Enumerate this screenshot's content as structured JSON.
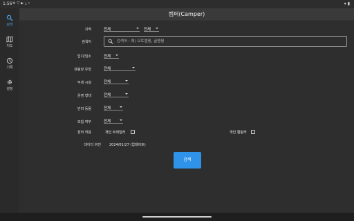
{
  "status_bar": {
    "time": "1:56",
    "icons": [
      "gear-icon",
      "shield-icon",
      "play-icon",
      "download-icon",
      "dot-icon"
    ],
    "right_icons": [
      "wifi-icon",
      "battery-icon"
    ]
  },
  "nav_rail": {
    "items": [
      {
        "label": "검색",
        "icon": "search-icon",
        "active": true
      },
      {
        "label": "지도",
        "icon": "map-icon",
        "active": false
      },
      {
        "label": "기록",
        "icon": "history-icon",
        "active": false
      },
      {
        "label": "설정",
        "icon": "settings-icon",
        "active": false
      }
    ]
  },
  "app_bar": {
    "title": "캠퍼(Camper)"
  },
  "form": {
    "region": {
      "label": "지역",
      "value1": "전체",
      "value2": "전체"
    },
    "keyword": {
      "label": "검색어",
      "placeholder": "검색어 : 예) 오토캠핑, 글램핑"
    },
    "business": {
      "label": "업지/임소",
      "value": "전체"
    },
    "camp_type": {
      "label": "캠핑장 유형",
      "value": "전체"
    },
    "facilities": {
      "label": "부대 시설",
      "value": "전체"
    },
    "operation": {
      "label": "운영 형태",
      "value": "전체"
    },
    "pets": {
      "label": "반려 동물",
      "value": "전체"
    },
    "insurance": {
      "label": "보험 여부",
      "value": "전체"
    },
    "equipment": {
      "label": "장비 허용",
      "option1": "개인 트레일러",
      "option2": "개인 캠핑카"
    },
    "data_version": {
      "label": "데이터 버전",
      "value": "2024/01/27 (업데이트)"
    },
    "submit_label": "검색"
  },
  "colors": {
    "accent": "#2f93ea",
    "active_nav": "#4aa3f0",
    "background": "#2d2d2d",
    "app_bar": "#3a3a3a"
  }
}
